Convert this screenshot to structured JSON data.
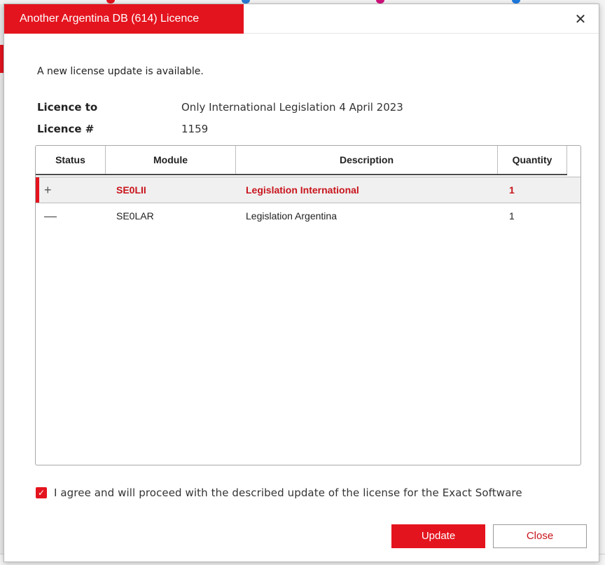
{
  "dialog": {
    "title": "Another Argentina DB (614) Licence",
    "close_glyph": "✕"
  },
  "notice": "A new license update is available.",
  "licence_to": {
    "label": "Licence to",
    "value": "Only International Legislation 4 April 2023"
  },
  "licence_no": {
    "label": "Licence #",
    "value": "1159"
  },
  "table": {
    "headers": {
      "status": "Status",
      "module": "Module",
      "description": "Description",
      "quantity": "Quantity"
    },
    "rows": [
      {
        "status": "+",
        "module": "SE0LII",
        "description": "Legislation International",
        "quantity": "1"
      },
      {
        "status": "—",
        "module": "SE0LAR",
        "description": "Legislation Argentina",
        "quantity": "1"
      }
    ]
  },
  "agree": {
    "checked": true,
    "check_glyph": "✓",
    "text": "I agree and will proceed with the described update of the license for the Exact Software"
  },
  "buttons": {
    "update": "Update",
    "close": "Close"
  },
  "colors": {
    "accent": "#e4141e",
    "accent_text": "#c8141c",
    "selected_row": "#f0f0f0"
  },
  "icons": {
    "close": "close-icon",
    "checkbox": "checkmark-icon"
  }
}
